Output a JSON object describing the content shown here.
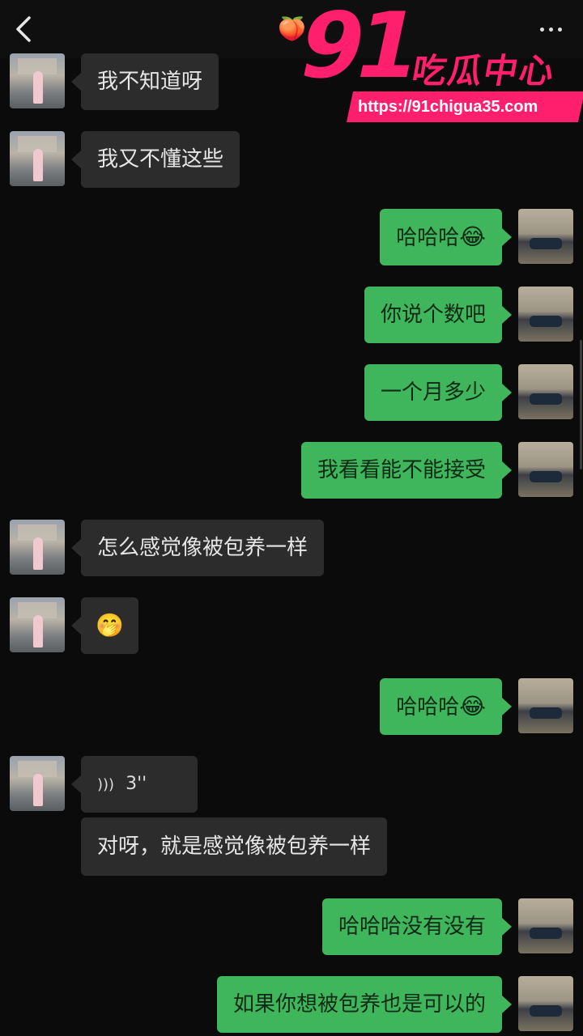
{
  "header": {
    "back_icon": "chevron-left-icon",
    "title_emoji": "🍑",
    "more_icon": "more-dots-icon"
  },
  "watermark": {
    "brand": "91",
    "text": "吃瓜中心",
    "url": "https://91chigua35.com",
    "color": "#ff1f6d"
  },
  "messages": [
    {
      "side": "left",
      "text": "我不知道呀"
    },
    {
      "side": "left",
      "text": "我又不懂这些"
    },
    {
      "side": "right",
      "text": "哈哈哈",
      "emoji": "😂"
    },
    {
      "side": "right",
      "text": "你说个数吧"
    },
    {
      "side": "right",
      "text": "一个月多少"
    },
    {
      "side": "right",
      "text": "我看看能不能接受"
    },
    {
      "side": "left",
      "text": "怎么感觉像被包养一样"
    },
    {
      "side": "left",
      "emoji": "🤭"
    },
    {
      "side": "right",
      "text": "哈哈哈",
      "emoji": "😂"
    },
    {
      "side": "left",
      "type": "voice",
      "duration": "3''",
      "icon": "voice-wave-icon"
    },
    {
      "side": "left",
      "text": "对呀，就是感觉像被包养一样"
    },
    {
      "side": "right",
      "text": "哈哈哈没有没有"
    },
    {
      "side": "right",
      "text": "如果你想被包养也是可以的"
    }
  ],
  "colors": {
    "background": "#0b0b0b",
    "incoming_bubble": "#2c2c2c",
    "outgoing_bubble": "#3fb55c"
  }
}
